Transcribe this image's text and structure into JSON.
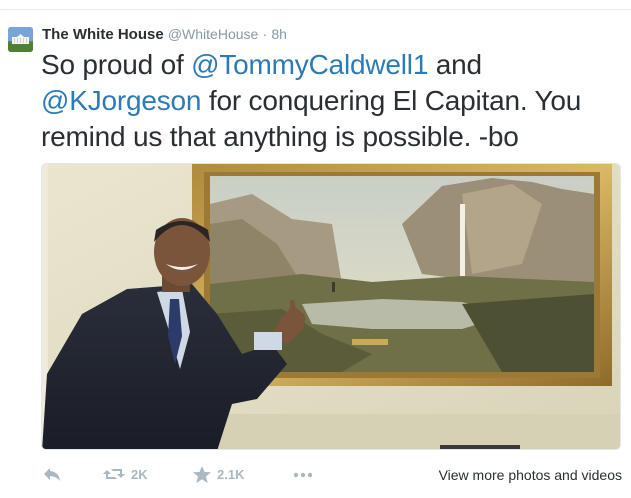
{
  "tweet": {
    "display_name": "The White House",
    "handle": "@WhiteHouse",
    "separator": "·",
    "time": "8h",
    "text_part1": "So proud of ",
    "mention1": "@TommyCaldwell1",
    "text_part2": " and ",
    "mention2": "@KJorgeson",
    "text_part3": " for conquering El Capitan. You remind us that anything is possible. -bo"
  },
  "actions": {
    "reply_icon": "reply-icon",
    "retweet_icon": "retweet-icon",
    "retweet_count": "2K",
    "favorite_icon": "star-icon",
    "favorite_count": "2.1K",
    "more_icon": "more-dots-icon",
    "view_more_link": "View more photos and videos"
  },
  "colors": {
    "link": "#2b7bb9",
    "text": "#292f33",
    "muted": "#8899a6",
    "action_gray": "#aab8c2"
  }
}
